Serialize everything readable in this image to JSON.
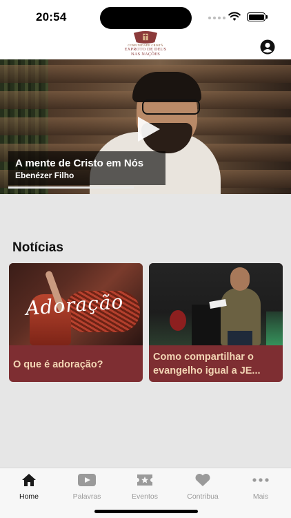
{
  "status_bar": {
    "time": "20:54",
    "icons": [
      "signal-dots-icon",
      "wifi-icon",
      "battery-icon"
    ]
  },
  "header": {
    "logo": {
      "small_text": "COMUNIDADE CRISTÃ",
      "line1": "EXPROTO DE DEUS",
      "line2": "NAS NAÇÕES"
    },
    "profile_icon": "person-circle-icon"
  },
  "hero": {
    "title": "A mente de Cristo em Nós",
    "speaker": "Ebenézer Filho",
    "play_icon": "play-icon",
    "progress": 0.43
  },
  "news": {
    "section_title": "Notícias",
    "cards": [
      {
        "image_text": "Adoração",
        "title": "O que é adoração?"
      },
      {
        "title": "Como compartilhar o evangelho igual a JE..."
      }
    ]
  },
  "tabbar": {
    "tabs": [
      {
        "label": "Home",
        "icon": "home-icon",
        "active": true
      },
      {
        "label": "Palavras",
        "icon": "video-play-icon",
        "active": false
      },
      {
        "label": "Eventos",
        "icon": "ticket-star-icon",
        "active": false
      },
      {
        "label": "Contribua",
        "icon": "heart-icon",
        "active": false
      },
      {
        "label": "Mais",
        "icon": "more-dots-icon",
        "active": false
      }
    ]
  },
  "colors": {
    "accent": "#7e2e32",
    "card_text": "#f2d5b4",
    "background": "#e6e6e6"
  }
}
